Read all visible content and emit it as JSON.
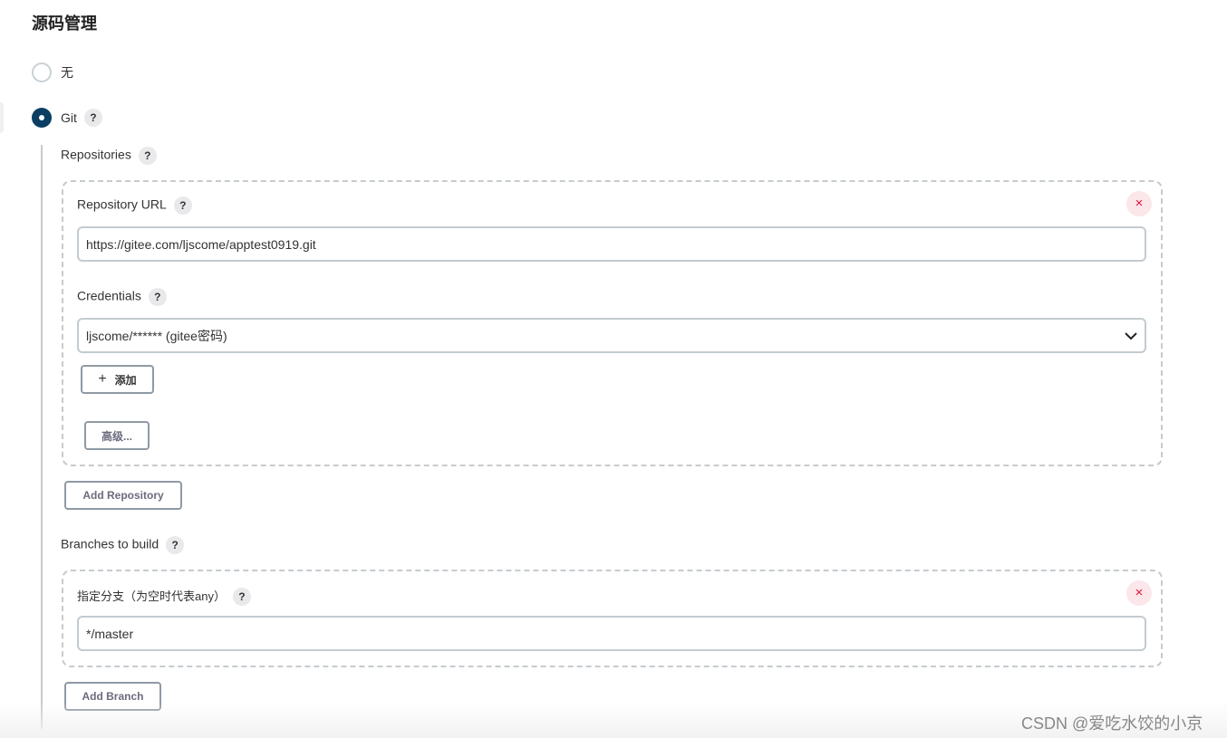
{
  "section_title": "源码管理",
  "scm_options": [
    {
      "label": "无",
      "selected": false
    },
    {
      "label": "Git",
      "selected": true
    }
  ],
  "repositories": {
    "label": "Repositories",
    "url_label": "Repository URL",
    "url_value": "https://gitee.com/ljscome/apptest0919.git",
    "credentials_label": "Credentials",
    "credentials_value": "ljscome/****** (gitee密码)",
    "add_label": "添加",
    "advanced_label": "高级...",
    "delete_icon": "×",
    "add_repository_label": "Add Repository"
  },
  "branches": {
    "label": "Branches to build",
    "specifier_label": "指定分支（为空时代表any）",
    "specifier_value": "*/master",
    "delete_icon": "×",
    "add_branch_label": "Add Branch"
  },
  "help_glyph": "?",
  "watermark": "CSDN @爱吃水饺的小京",
  "colors": {
    "radio_selected": "#0b3e62",
    "delete": "#e2103c",
    "delete_bg": "#fbe6e9"
  }
}
